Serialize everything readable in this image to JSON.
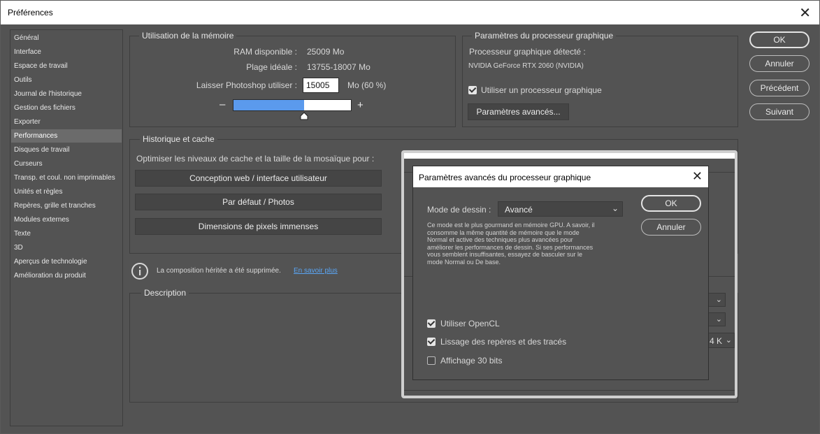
{
  "window": {
    "title": "Préférences"
  },
  "sidebar": {
    "items": [
      {
        "label": "Général"
      },
      {
        "label": "Interface"
      },
      {
        "label": "Espace de travail"
      },
      {
        "label": "Outils"
      },
      {
        "label": "Journal de l'historique"
      },
      {
        "label": "Gestion des fichiers"
      },
      {
        "label": "Exporter"
      },
      {
        "label": "Performances"
      },
      {
        "label": "Disques de travail"
      },
      {
        "label": "Curseurs"
      },
      {
        "label": "Transp. et coul. non imprimables"
      },
      {
        "label": "Unités et règles"
      },
      {
        "label": "Repères, grille et tranches"
      },
      {
        "label": "Modules externes"
      },
      {
        "label": "Texte"
      },
      {
        "label": "3D"
      },
      {
        "label": "Aperçus de technologie"
      },
      {
        "label": "Amélioration du produit"
      }
    ],
    "selected": "Performances"
  },
  "memory": {
    "title": "Utilisation de la mémoire",
    "ram_label": "RAM disponible :",
    "ram_value": "25009 Mo",
    "ideal_label": "Plage idéale :",
    "ideal_value": "13755-18007 Mo",
    "let_label": "Laisser Photoshop utiliser :",
    "let_value": "15005",
    "let_unit": "Mo (60 %)",
    "minus": "–",
    "plus": "+",
    "slider_fraction": 0.6
  },
  "gpu": {
    "title": "Paramètres du processeur graphique",
    "detected_label": "Processeur graphique détecté :",
    "detected_value": "NVIDIA GeForce RTX 2060 (NVIDIA)",
    "use_gpu_label": "Utiliser un processeur graphique",
    "use_gpu_checked": true,
    "advanced_button": "Paramètres avancés..."
  },
  "history": {
    "title": "Historique et cache",
    "optimize_label": "Optimiser les niveaux de cache et la taille de la mosaïque pour :",
    "buttons": [
      "Conception web / interface utilisateur",
      "Par défaut / Photos",
      "Dimensions de pixels immenses"
    ]
  },
  "notice": {
    "text": "La composition héritée a été supprimée.",
    "link": "En savoir plus"
  },
  "description": {
    "title": "Description"
  },
  "actions": {
    "ok": "OK",
    "cancel": "Annuler",
    "prev": "Précédent",
    "next": "Suivant"
  },
  "partial": {
    "k_label": "4 K"
  },
  "dialog": {
    "title": "Paramètres avancés du processeur graphique",
    "mode_label": "Mode de dessin :",
    "mode_value": "Avancé",
    "ok": "OK",
    "cancel": "Annuler",
    "description_lines": [
      "Ce mode est le plus gourmand en mémoire GPU. A savoir, il",
      "consomme la même quantité de mémoire que le mode",
      "Normal et active des techniques plus avancées pour",
      "améliorer les performances de dessin. Si ses performances",
      "vous semblent insuffisantes, essayez de basculer sur le",
      "mode Normal ou De base."
    ],
    "checkboxes": [
      {
        "label": "Utiliser OpenCL",
        "checked": true
      },
      {
        "label": "Lissage des repères et des tracés",
        "checked": true
      },
      {
        "label": "Affichage 30 bits",
        "checked": false
      }
    ]
  },
  "colors": {
    "accent": "#5b9aed",
    "background": "#535353",
    "link": "#5aa6f5"
  }
}
